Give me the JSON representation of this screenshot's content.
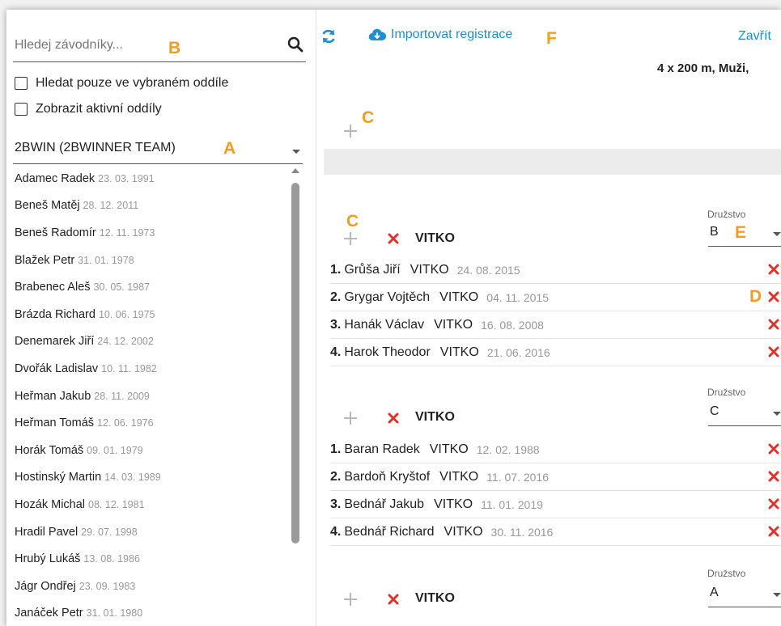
{
  "search": {
    "placeholder": "Hledej závodníky..."
  },
  "filters": [
    {
      "label": "Hledat pouze ve vybraném oddíle"
    },
    {
      "label": "Zobrazit aktivní oddíly"
    }
  ],
  "club_select": {
    "value": "2BWIN (2BWINNER TEAM)"
  },
  "athletes": [
    {
      "name": "Adamec Radek",
      "date": "23. 03. 1991"
    },
    {
      "name": "Beneš Matěj",
      "date": "28. 12. 2011"
    },
    {
      "name": "Beneš Radomír",
      "date": "12. 11. 1973"
    },
    {
      "name": "Blažek Petr",
      "date": "31. 01. 1978"
    },
    {
      "name": "Brabenec Aleš",
      "date": "30. 05. 1987"
    },
    {
      "name": "Brázda Richard",
      "date": "10. 06. 1975"
    },
    {
      "name": "Denemarek Jiří",
      "date": "24. 12. 2002"
    },
    {
      "name": "Dvořák Ladislav",
      "date": "10. 11. 1982"
    },
    {
      "name": "Heřman Jakub",
      "date": "28. 11. 2009"
    },
    {
      "name": "Heřman Tomáš",
      "date": "12. 06. 1976"
    },
    {
      "name": "Horák Tomáš",
      "date": "09. 01. 1979"
    },
    {
      "name": "Hostinský Martin",
      "date": "14. 03. 1989"
    },
    {
      "name": "Hozák Michal",
      "date": "08. 12. 1981"
    },
    {
      "name": "Hradil Pavel",
      "date": "29. 07. 1998"
    },
    {
      "name": "Hrubý Lukáš",
      "date": "13. 08. 1986"
    },
    {
      "name": "Jágr Ondřej",
      "date": "23. 09. 1983"
    },
    {
      "name": "Janáček Petr",
      "date": "31. 01. 1980"
    }
  ],
  "toolbar": {
    "import_label": "Importovat registrace",
    "close_label": "Zavřít"
  },
  "event_title": "4 x 200 m, Muži,",
  "markers": {
    "a": "A",
    "b": "B",
    "c": "C",
    "d": "D",
    "e": "E",
    "f": "F"
  },
  "druzstvo_label": "Družstvo",
  "teams": [
    {
      "name": "VITKO",
      "druzstvo": "B",
      "members": [
        {
          "num": "1.",
          "name": "Grůša Jiří",
          "club": "VITKO",
          "date": "24. 08. 2015"
        },
        {
          "num": "2.",
          "name": "Grygar Vojtěch",
          "club": "VITKO",
          "date": "04. 11. 2015"
        },
        {
          "num": "3.",
          "name": "Hanák Václav",
          "club": "VITKO",
          "date": "16. 08. 2008"
        },
        {
          "num": "4.",
          "name": "Harok Theodor",
          "club": "VITKO",
          "date": "21. 06. 2016"
        }
      ]
    },
    {
      "name": "VITKO",
      "druzstvo": "C",
      "members": [
        {
          "num": "1.",
          "name": "Baran Radek",
          "club": "VITKO",
          "date": "12. 02. 1988"
        },
        {
          "num": "2.",
          "name": "Bardoň Kryštof",
          "club": "VITKO",
          "date": "11. 07. 2016"
        },
        {
          "num": "3.",
          "name": "Bednář Jakub",
          "club": "VITKO",
          "date": "11. 01. 2019"
        },
        {
          "num": "4.",
          "name": "Bednář Richard",
          "club": "VITKO",
          "date": "30. 11. 2016"
        }
      ]
    },
    {
      "name": "VITKO",
      "druzstvo": "A",
      "members": []
    }
  ],
  "colors": {
    "accent": "#1e8fd2",
    "delete": "#e0322b",
    "marker": "#f39c1e"
  }
}
